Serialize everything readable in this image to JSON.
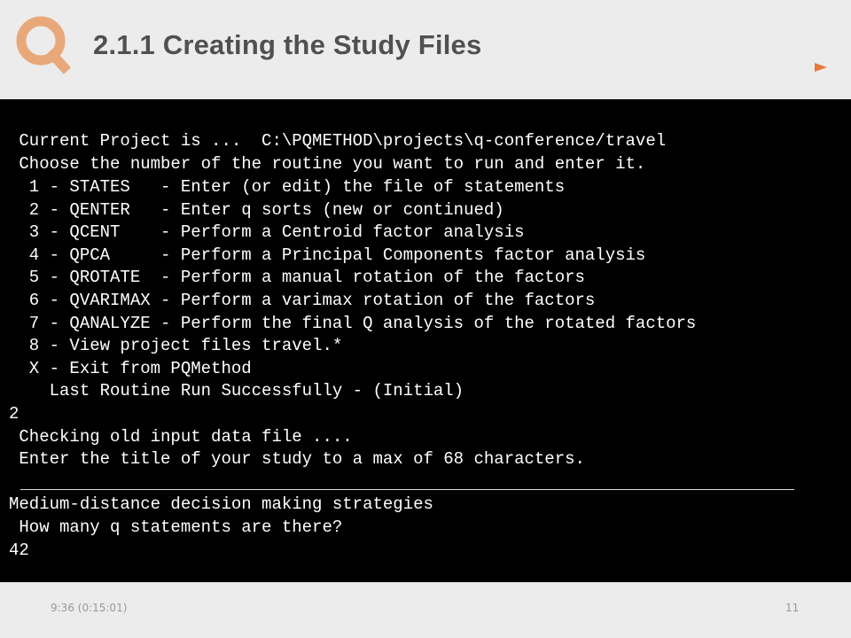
{
  "slide": {
    "logo_letter": "Q",
    "title": "2.1.1 Creating the Study Files",
    "accent_color": "#e8914a"
  },
  "terminal": {
    "current_project": " Current Project is ...  C:\\PQMETHOD\\projects\\q-conference/travel",
    "choose_prompt": " Choose the number of the routine you want to run and enter it.",
    "menu": [
      "  1 - STATES   - Enter (or edit) the file of statements",
      "  2 - QENTER   - Enter q sorts (new or continued)",
      "  3 - QCENT    - Perform a Centroid factor analysis",
      "  4 - QPCA     - Perform a Principal Components factor analysis",
      "  5 - QROTATE  - Perform a manual rotation of the factors",
      "  6 - QVARIMAX - Perform a varimax rotation of the factors",
      "  7 - QANALYZE - Perform the final Q analysis of the rotated factors",
      "  8 - View project files travel.*",
      "  X - Exit from PQMethod"
    ],
    "last_routine": "    Last Routine Run Successfully - (Initial)",
    "user_choice": "2",
    "checking": " Checking old input data file ....",
    "title_prompt": " Enter the title of your study to a max of 68 characters.",
    "title_entered": "Medium-distance decision making strategies",
    "statements_prompt": " How many q statements are there?",
    "statements_entered": "42"
  },
  "footer": {
    "time": "9:36  (0:15:01)",
    "page_number": "11"
  }
}
